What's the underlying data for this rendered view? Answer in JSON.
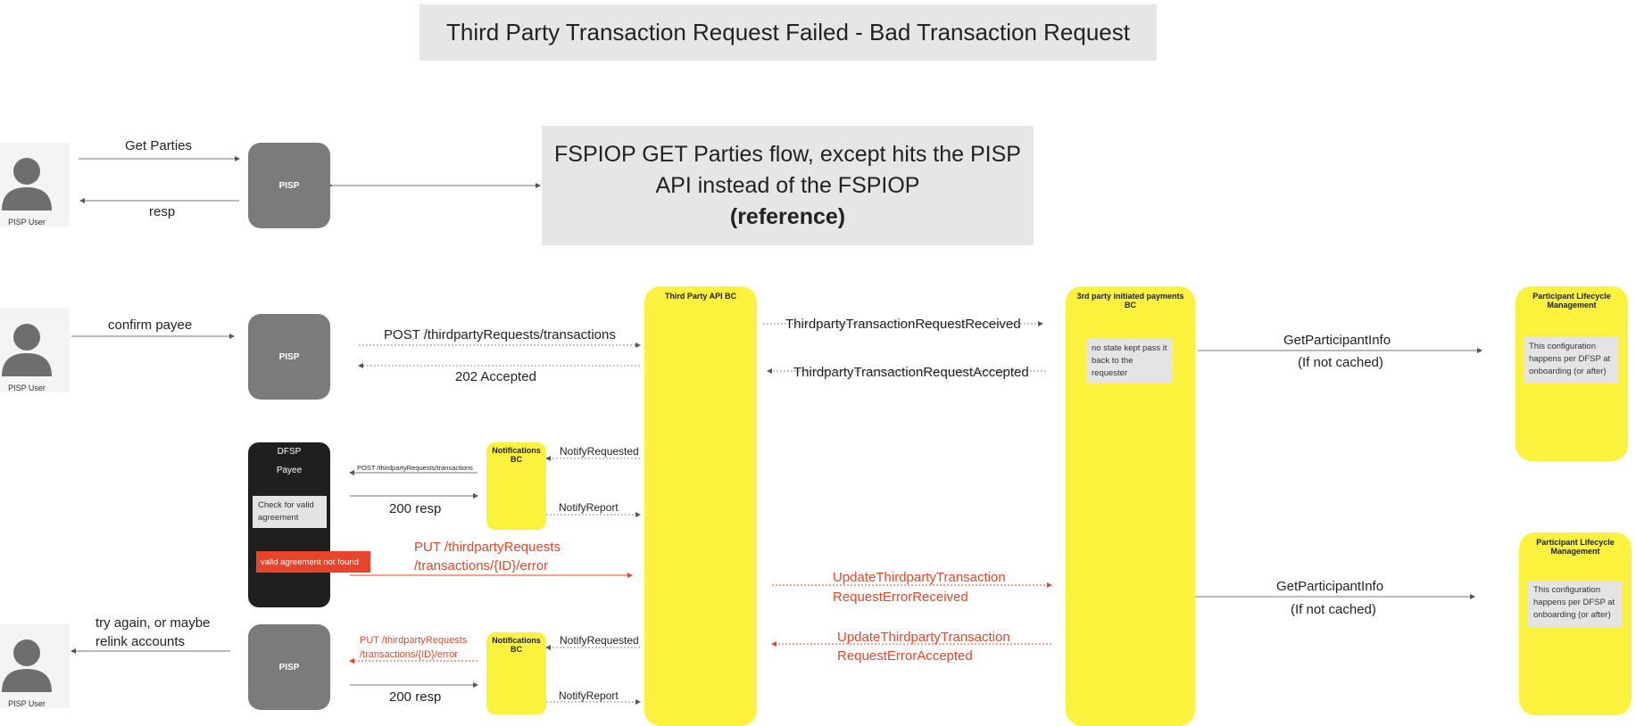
{
  "title": "Third Party Transaction Request Failed - Bad Transaction Request",
  "reference_box": {
    "line1": "FSPIOP GET Parties flow, except hits the PISP",
    "line2": "API instead of the FSPIOP",
    "line3": "(reference)"
  },
  "actors": {
    "pisp_user_label": "PISP User",
    "pisp_label": "PISP",
    "dfsp_label": "DFSP",
    "payee_label": "Payee"
  },
  "components": {
    "third_party_api_bc": "Third Party API BC",
    "third_party_payments_bc": "3rd party initiated payments BC",
    "participant_lifecycle": "Participant Lifecycle Management",
    "notifications_bc": "Notifications BC"
  },
  "notes": {
    "no_state": "no state kept pass it back to the requester",
    "config_per_dfsp": "This configuration happens per DFSP at onboarding (or after)",
    "check_agreement": "Check for valid agreement",
    "agreement_not_found": "valid agreement not found"
  },
  "messages": {
    "get_parties": "Get Parties",
    "resp": "resp",
    "confirm_payee": "confirm payee",
    "post_tp_transactions": "POST /thirdpartyRequests/transactions",
    "accepted_202": "202 Accepted",
    "tp_request_received": "ThirdpartyTransactionRequestReceived",
    "tp_request_accepted": "ThirdpartyTransactionRequestAccepted",
    "get_participant_info": "GetParticipantInfo",
    "if_not_cached": "(If not cached)",
    "notify_requested": "NotifyRequested",
    "notify_report": "NotifyReport",
    "post_tp_transactions_small": "POST /thirdpartyRequests/transactions",
    "resp_200": "200 resp",
    "put_error_line1": "PUT /thirdpartyRequests",
    "put_error_line2": "/transactions/{ID}/error",
    "update_error_received_1": "UpdateThirdpartyTransaction",
    "update_error_received_2": "RequestErrorReceived",
    "update_error_accepted_1": "UpdateThirdpartyTransaction",
    "update_error_accepted_2": "RequestErrorAccepted",
    "try_again_1": "try again, or maybe",
    "try_again_2": "relink accounts"
  },
  "colors": {
    "yellow": "#fcf23d",
    "error_red": "#e8442a",
    "pisp_gray": "#7b7b7b",
    "dfsp_black": "#1f1f1f",
    "note_gray": "#e4e4e4"
  }
}
